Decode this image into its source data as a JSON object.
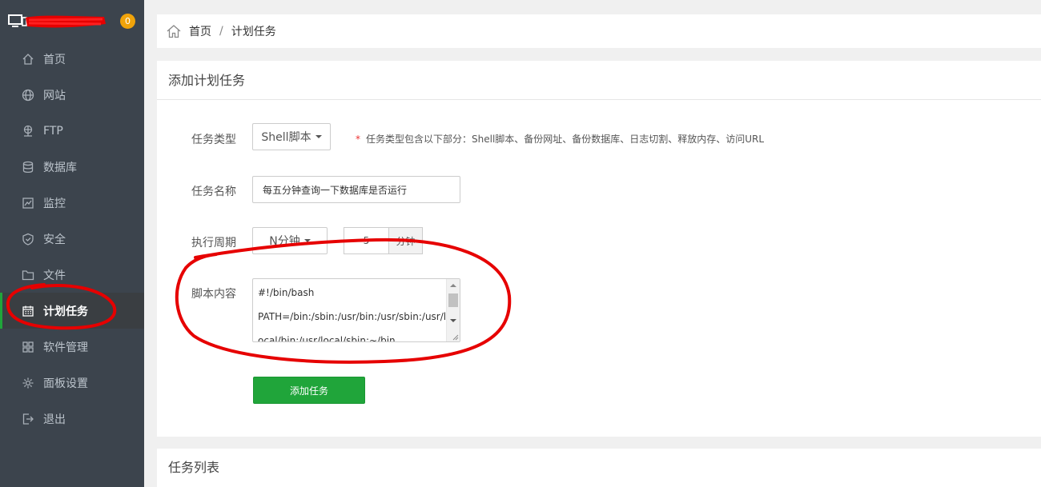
{
  "sidebar": {
    "badge": "0",
    "active_color": "#20a53a",
    "items": [
      {
        "label": "首页",
        "icon": "home-icon"
      },
      {
        "label": "网站",
        "icon": "globe-icon"
      },
      {
        "label": "FTP",
        "icon": "ftp-icon"
      },
      {
        "label": "数据库",
        "icon": "database-icon"
      },
      {
        "label": "监控",
        "icon": "monitor-chart-icon"
      },
      {
        "label": "安全",
        "icon": "shield-icon"
      },
      {
        "label": "文件",
        "icon": "folder-icon"
      },
      {
        "label": "计划任务",
        "icon": "calendar-icon",
        "active": true
      },
      {
        "label": "软件管理",
        "icon": "grid-icon"
      },
      {
        "label": "面板设置",
        "icon": "gear-icon"
      },
      {
        "label": "退出",
        "icon": "logout-icon"
      }
    ]
  },
  "breadcrumb": {
    "home": "首页",
    "separator": "/",
    "current": "计划任务"
  },
  "form": {
    "title": "添加计划任务",
    "task_type": {
      "label": "任务类型",
      "value": "Shell脚本",
      "hint_star": "*",
      "hint": "任务类型包含以下部分：Shell脚本、备份网址、备份数据库、日志切割、释放内存、访问URL"
    },
    "task_name": {
      "label": "任务名称",
      "value": "每五分钟查询一下数据库是否运行"
    },
    "cycle": {
      "label": "执行周期",
      "value": "N分钟",
      "minutes": "5",
      "unit": "分钟"
    },
    "script": {
      "label": "脚本内容",
      "lines": [
        "#!/bin/bash",
        "PATH=/bin:/sbin:/usr/bin:/usr/sbin:/usr/l",
        "ocal/bin:/usr/local/sbin:~/bin"
      ]
    },
    "submit": "添加任务"
  },
  "task_list": {
    "title": "任务列表"
  },
  "annotation_color": "#e60000"
}
